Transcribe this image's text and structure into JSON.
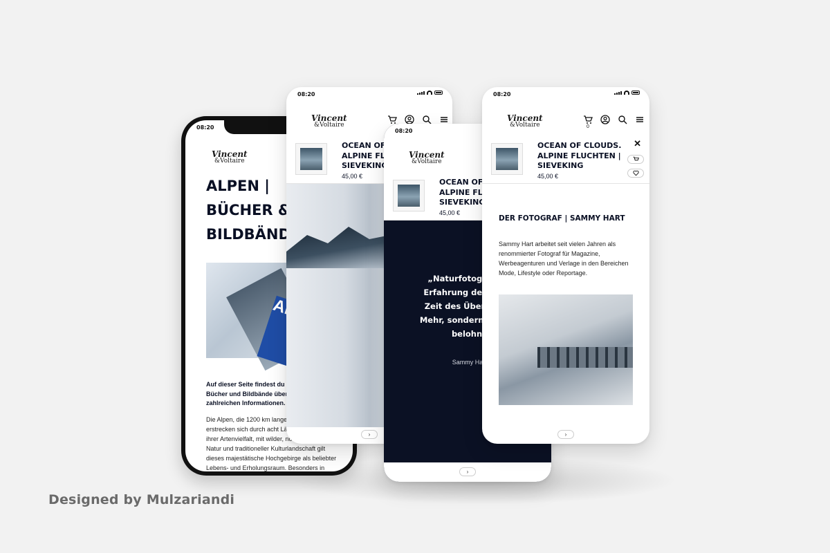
{
  "credit": "Designed by Mulzariandi",
  "status_time": "08:20",
  "logo": {
    "line1": "Vincent",
    "line2": "&Voltaire"
  },
  "cart_count": "0",
  "product": {
    "title_full": "OCEAN OF CLOUDS.\nALPINE FLUCHTEN |\nSIEVEKING",
    "title_cut_s2": "OCEAN OF C\nALPINE FLUCHTEN\nSIEVEKING",
    "title_cut_s3": "OCEAN OF C\nALPINE FLUC\nSIEVEKING",
    "price": "45,00 €"
  },
  "phone1": {
    "title": "ALPEN |\nBÜCHER &\nBILDBÄNDE",
    "lead": "Auf dieser Seite findest du die\nBücher und Bildbände über die\nzahlreichen Informationen.",
    "body": "Die Alpen, die 1200 km lange Ge\nerstrecken sich durch acht Länd\nihrer Artenvielfalt, mit wilder, noc\nNatur und traditioneller Kulturlandschaft gilt\ndieses majestätische Hochgebirge als beliebter\nLebens- und Erholungsraum. Besonders in",
    "image_book_text": "ALPIN"
  },
  "screen3": {
    "quote": "„Naturfotografie w\nErfahrung der Reduk\nZeit des Überflusses\nMehr, sondern ein Wer\nbelohnt.",
    "author": "Sammy Hart,"
  },
  "screen4": {
    "heading": "DER FOTOGRAF | SAMMY HART",
    "body": "Sammy Hart arbeitet seit vielen Jahren als\nrenommierter Fotograf für Magazine,\nWerbeagenturen und Verlage in den Bereichen\nMode, Lifestyle oder Reportage."
  },
  "next_label": "›",
  "icons": [
    "cart-icon",
    "account-icon",
    "search-icon",
    "menu-icon",
    "close-icon",
    "heart-icon"
  ],
  "colors": {
    "navy": "#0b1124",
    "background": "#f2f2f2"
  }
}
